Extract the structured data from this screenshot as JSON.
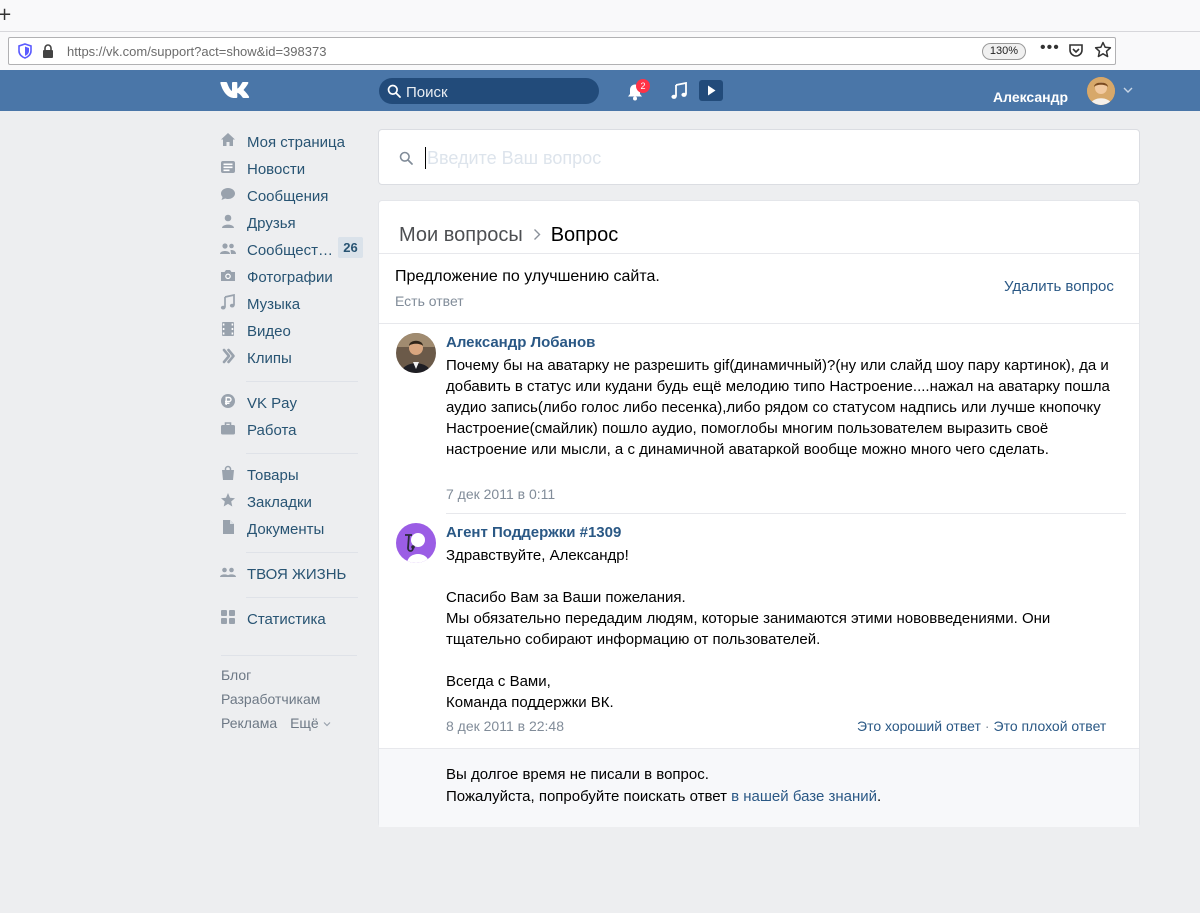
{
  "browser": {
    "new_tab_glyph": "+",
    "url": "https://vk.com/support?act=show&id=398373",
    "zoom": "130%",
    "more_glyph": "•••"
  },
  "header": {
    "search_placeholder": "Поиск",
    "notifications_count": "2",
    "user_name": "Александр",
    "accent_color": "#4a76a8"
  },
  "sidebar": {
    "items": [
      {
        "label": "Моя страница",
        "icon": "home-icon"
      },
      {
        "label": "Новости",
        "icon": "news-icon"
      },
      {
        "label": "Сообщения",
        "icon": "messages-icon"
      },
      {
        "label": "Друзья",
        "icon": "friends-icon"
      },
      {
        "label": "Сообщест…",
        "icon": "communities-icon",
        "count": "26"
      },
      {
        "label": "Фотографии",
        "icon": "camera-icon"
      },
      {
        "label": "Музыка",
        "icon": "music-icon"
      },
      {
        "label": "Видео",
        "icon": "video-icon"
      },
      {
        "label": "Клипы",
        "icon": "clips-icon"
      },
      {
        "label": "VK Pay",
        "icon": "vkpay-icon"
      },
      {
        "label": "Работа",
        "icon": "work-icon"
      },
      {
        "label": "Товары",
        "icon": "bag-icon"
      },
      {
        "label": "Закладки",
        "icon": "star-icon"
      },
      {
        "label": "Документы",
        "icon": "document-icon"
      },
      {
        "label": "ТВОЯ ЖИЗНЬ",
        "icon": "community-icon"
      },
      {
        "label": "Статистика",
        "icon": "stats-icon"
      }
    ],
    "footer": {
      "blog": "Блог",
      "developers": "Разработчикам",
      "ads": "Реклама",
      "more": "Ещё"
    }
  },
  "ask": {
    "placeholder": "Введите Ваш вопрос"
  },
  "question": {
    "breadcrumb_parent": "Мои вопросы",
    "breadcrumb_current": "Вопрос",
    "title": "Предложение по улучшению сайта.",
    "status": "Есть ответ",
    "delete_label": "Удалить вопрос"
  },
  "posts": [
    {
      "author": "Александр Лобанов",
      "text": "Почему бы на аватарку не разрешить gif(динамичный)?(ну или слайд шоу пару картинок), да и добавить в статус или кудани будь ещё мелодию типо Настроение....нажал на аватарку пошла аудио запись(либо голос либо песенка),либо рядом со статусом надпись или лучше кнопочку Настроение(смайлик) пошло аудио, помоглобы многим пользователем выразить своё настроение или мысли, а с динамичной аватаркой вообще можно много чего сделать.",
      "date": "7 дек 2011 в 0:11"
    },
    {
      "author": "Агент Поддержки #1309",
      "text": "Здравствуйте, Александр!\n\nСпасибо Вам за Ваши пожелания.\nМы обязательно передадим людям, которые занимаются этими нововведениями. Они тщательно собирают информацию от пользователей.\n\nВсегда с Вами,\nКоманда поддержки ВК.",
      "date": "8 дек 2011 в 22:48",
      "good_answer": "Это хороший ответ",
      "bad_answer": "Это плохой ответ",
      "separator": "·"
    }
  ],
  "notice": {
    "line1": "Вы долгое время не писали в вопрос.",
    "line2_prefix": "Пожалуйста, попробуйте поискать ответ ",
    "line2_link": "в нашей базе знаний",
    "line2_suffix": "."
  }
}
